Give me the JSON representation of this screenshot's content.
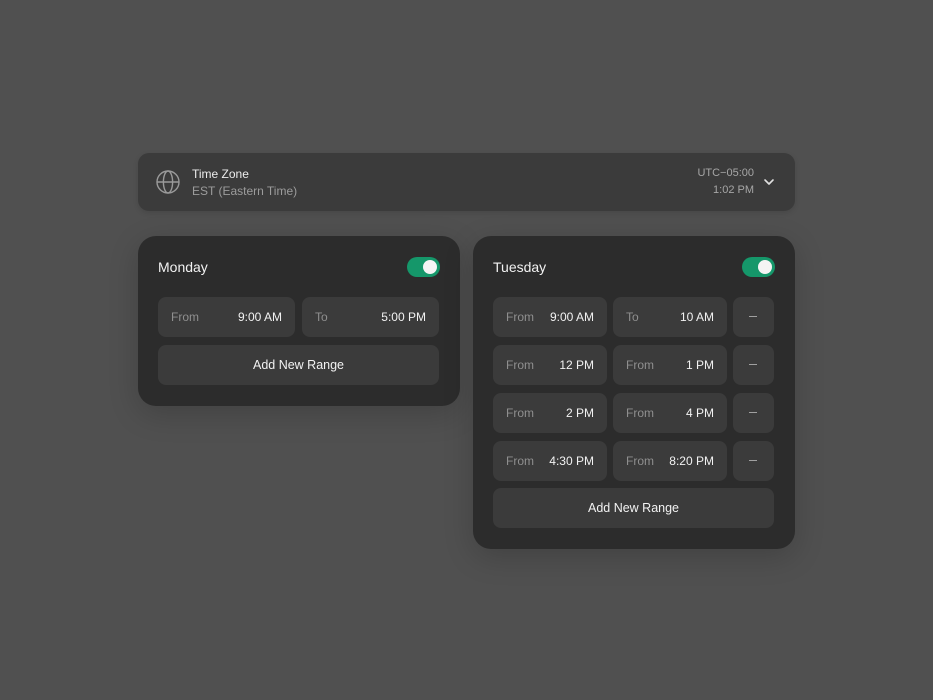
{
  "timezone": {
    "label": "Time Zone",
    "value": "EST (Eastern Time)",
    "offset": "UTC−05:00",
    "current_time": "1:02 PM",
    "icon": "globe-icon",
    "chevron_icon": "chevron-down-icon"
  },
  "accent_color": "#15976a",
  "monday": {
    "title": "Monday",
    "enabled": true,
    "ranges": [
      {
        "start_label": "From",
        "start_value": "9:00 AM",
        "end_label": "To",
        "end_value": "5:00 PM"
      }
    ],
    "add_label": "Add New Range"
  },
  "tuesday": {
    "title": "Tuesday",
    "enabled": true,
    "ranges": [
      {
        "start_label": "From",
        "start_value": "9:00 AM",
        "end_label": "To",
        "end_value": "10 AM"
      },
      {
        "start_label": "From",
        "start_value": "12 PM",
        "end_label": "From",
        "end_value": "1 PM"
      },
      {
        "start_label": "From",
        "start_value": "2 PM",
        "end_label": "From",
        "end_value": "4 PM"
      },
      {
        "start_label": "From",
        "start_value": "4:30 PM",
        "end_label": "From",
        "end_value": "8:20 PM"
      }
    ],
    "add_label": "Add New Range"
  }
}
